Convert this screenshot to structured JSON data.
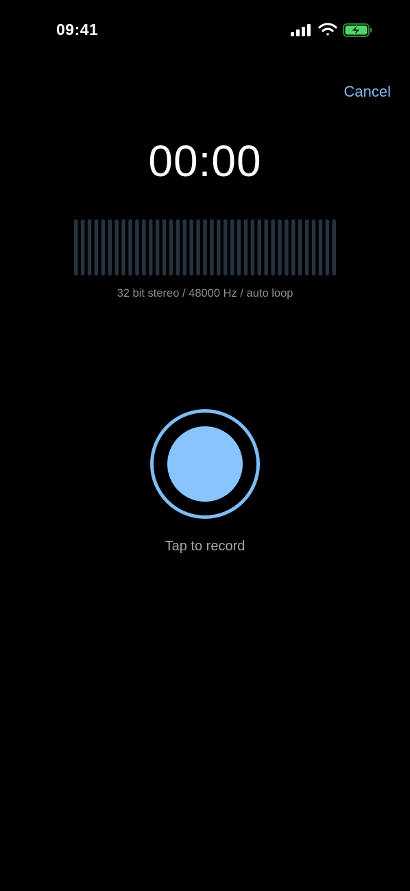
{
  "status_bar": {
    "time": "09:41",
    "icons": [
      "signal-icon",
      "wifi-icon",
      "battery-charging-icon"
    ]
  },
  "header": {
    "cancel_label": "Cancel"
  },
  "recorder": {
    "elapsed_time": "00:00",
    "format_info": "32 bit stereo / 48000 Hz / auto loop",
    "level_meter_bar_count": 39,
    "record_hint": "Tap to record"
  },
  "colors": {
    "background": "#000000",
    "accent": "#7fbcf6",
    "record_fill": "#88c4ff",
    "meter_bar": "#26323f",
    "battery_green": "#4cd964",
    "secondary_text": "#8e8e93"
  }
}
